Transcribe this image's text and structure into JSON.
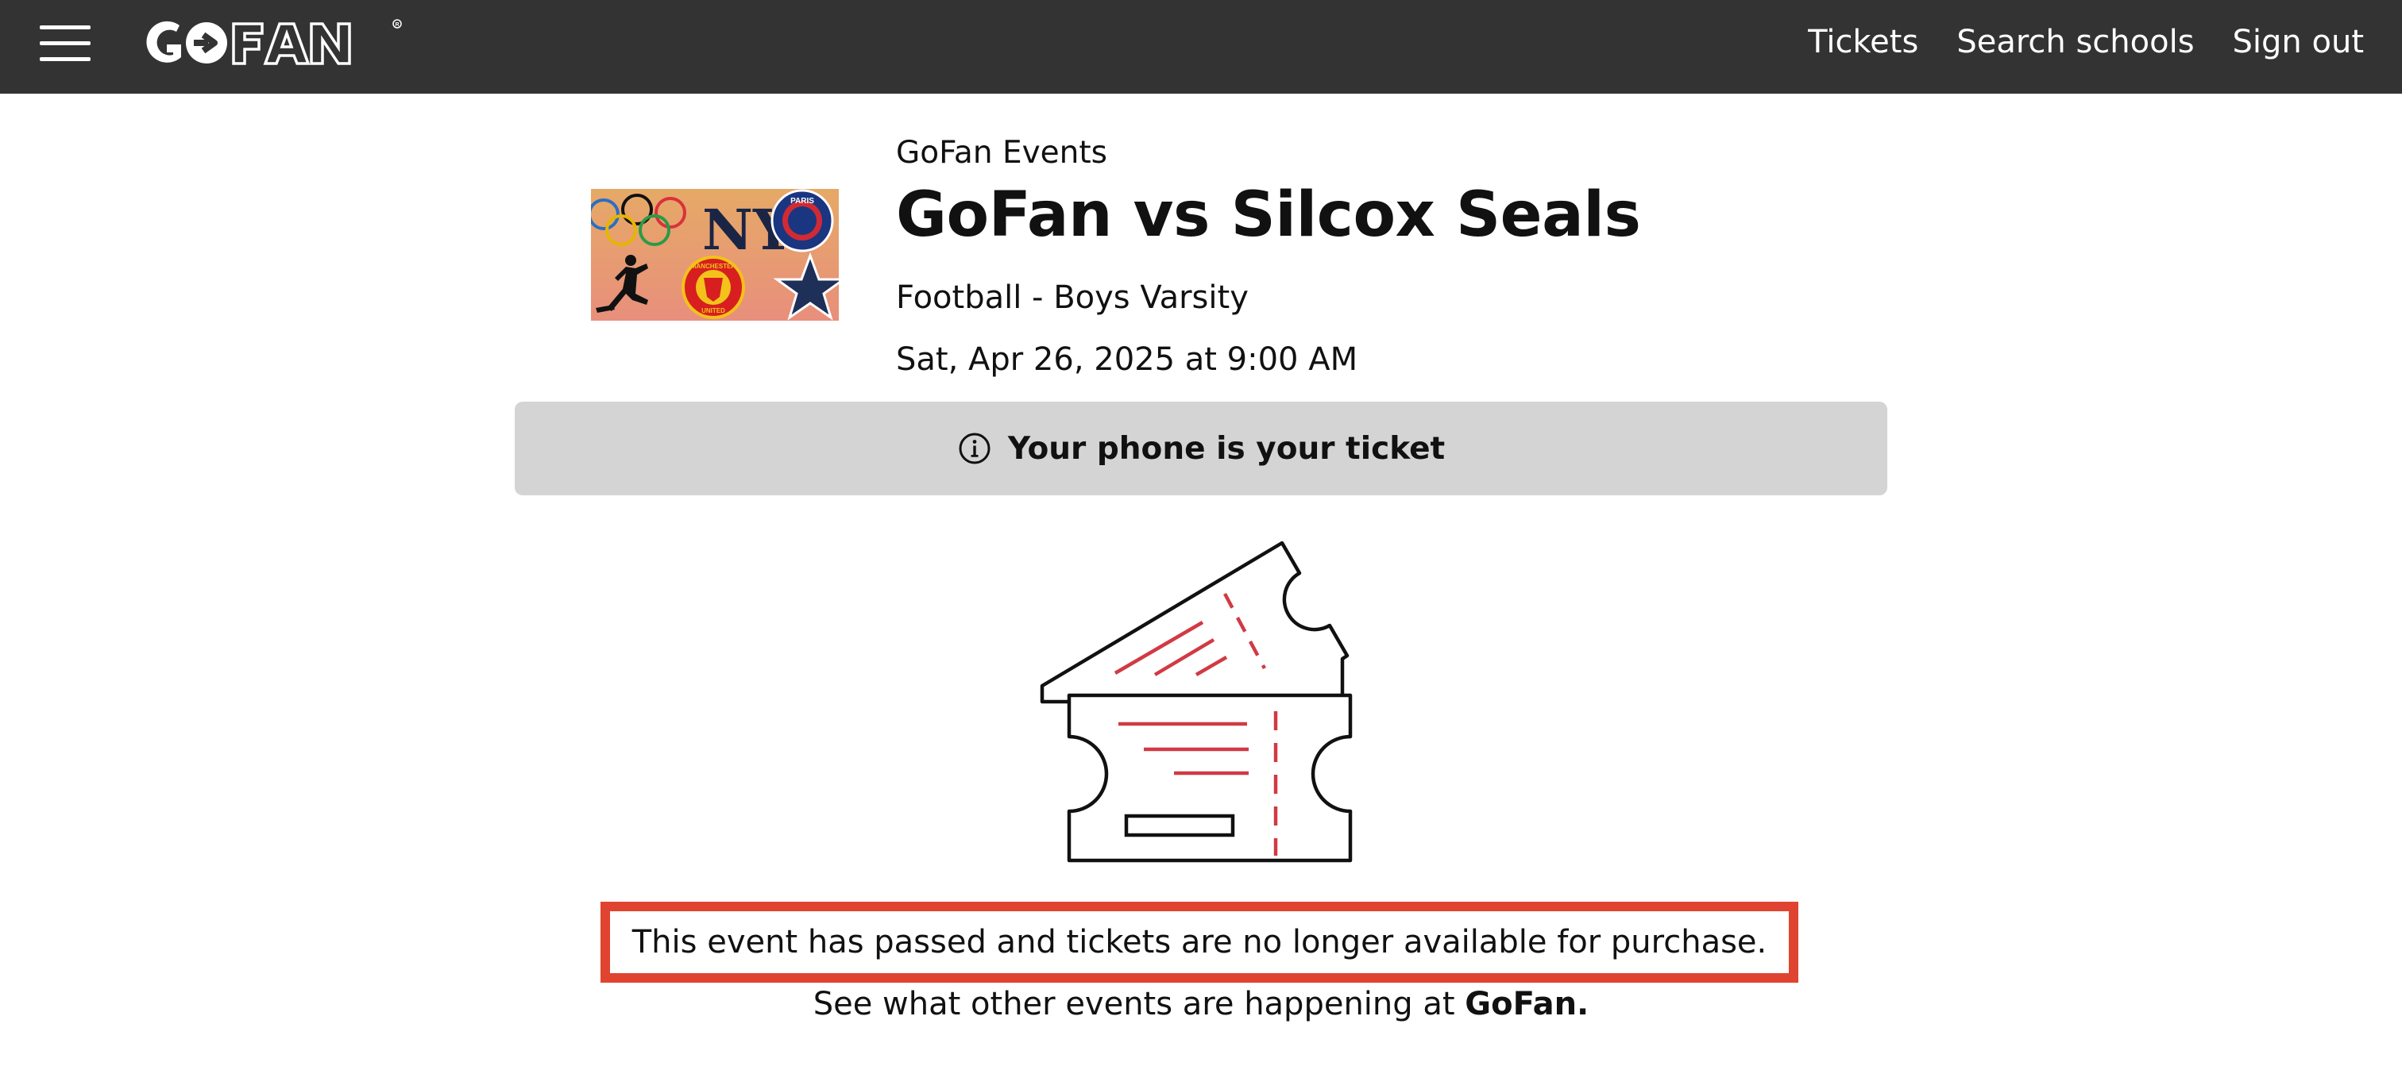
{
  "header": {
    "logo_text": "GOFAN",
    "nav": {
      "tickets": "Tickets",
      "search_schools": "Search schools",
      "sign_out": "Sign out"
    },
    "background_color": "#333333"
  },
  "event": {
    "organizer": "GoFan Events",
    "title": "GoFan vs Silcox Seals",
    "sport_level": "Football - Boys Varsity",
    "datetime": "Sat, Apr 26, 2025 at 9:00 AM",
    "image_contents": [
      "olympic-rings-logo",
      "ny-yankees-logo",
      "psg-paris-logo",
      "jumpman-logo",
      "manchester-united-logo",
      "dallas-star-logo"
    ]
  },
  "ticket_banner": {
    "icon": "info-icon",
    "text": "Your phone is your ticket"
  },
  "illustration": "tickets-illustration",
  "notice": {
    "text": "This event has passed and tickets are no longer available for purchase.",
    "border_color": "#e0432f"
  },
  "more_events": {
    "prefix": "See what other events are happening at ",
    "link_text": "GoFan."
  }
}
